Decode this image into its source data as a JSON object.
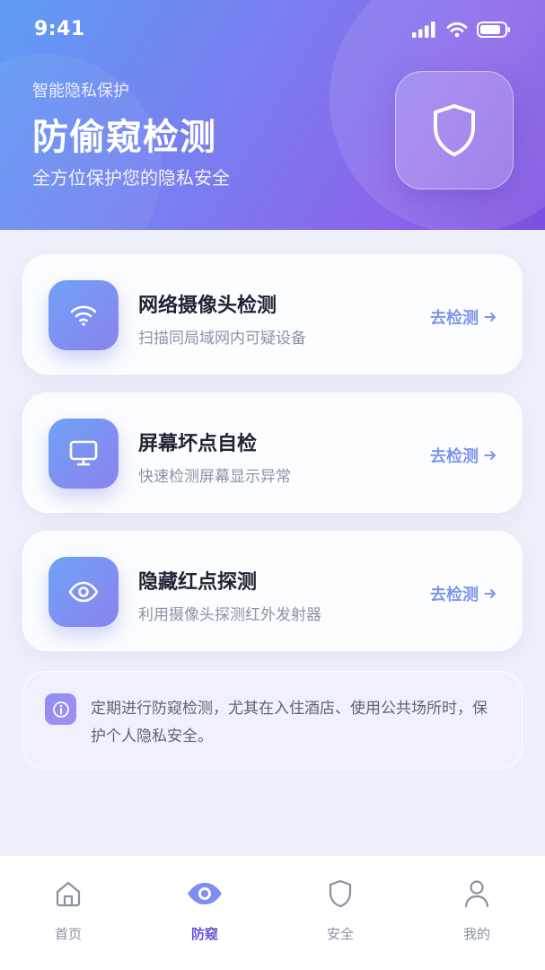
{
  "status_bar": {
    "time": "9:41"
  },
  "header": {
    "subtitle": "智能隐私保护",
    "title": "防偷窥检测",
    "description": "全方位保护您的隐私安全"
  },
  "cards": [
    {
      "icon": "wifi-icon",
      "title": "网络摄像头检测",
      "desc": "扫描同局域网内可疑设备",
      "action": "去检测"
    },
    {
      "icon": "monitor-icon",
      "title": "屏幕坏点自检",
      "desc": "快速检测屏幕显示异常",
      "action": "去检测"
    },
    {
      "icon": "eye-icon",
      "title": "隐藏红点探测",
      "desc": "利用摄像头探测红外发射器",
      "action": "去检测"
    }
  ],
  "notice": {
    "text": "定期进行防窥检测，尤其在入住酒店、使用公共场所时，保护个人隐私安全。"
  },
  "tabbar": {
    "items": [
      {
        "icon": "home-icon",
        "label": "首页",
        "active": false
      },
      {
        "icon": "eye-icon",
        "label": "防窥",
        "active": true
      },
      {
        "icon": "shield-icon",
        "label": "安全",
        "active": false
      },
      {
        "icon": "user-icon",
        "label": "我的",
        "active": false
      }
    ]
  },
  "colors": {
    "accent": "#6a55d9",
    "action": "#7f95ea",
    "header_gradient_start": "#5f9cf5",
    "header_gradient_end": "#7a4fe0"
  }
}
